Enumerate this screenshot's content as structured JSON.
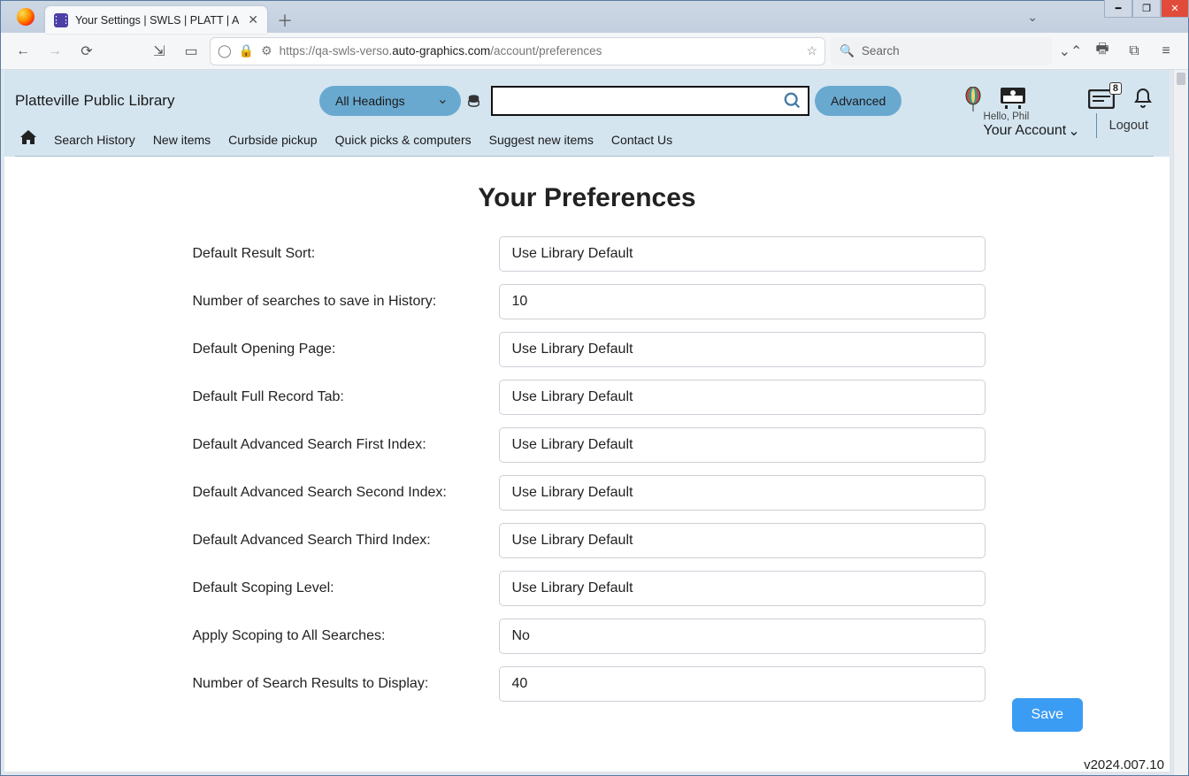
{
  "browser": {
    "tab_title": "Your Settings | SWLS | PLATT | A",
    "url_prefix": "https://qa-swls-verso.",
    "url_domain": "auto-graphics.com",
    "url_path": "/account/preferences",
    "search_placeholder": "Search"
  },
  "header": {
    "library_name": "Platteville Public Library",
    "headings_dropdown": "All Headings",
    "advanced": "Advanced",
    "badge_count": "8",
    "hello": "Hello, Phil",
    "your_account": "Your Account",
    "logout": "Logout"
  },
  "nav": {
    "items": [
      "Search History",
      "New items",
      "Curbside pickup",
      "Quick picks & computers",
      "Suggest new items",
      "Contact Us"
    ]
  },
  "page": {
    "title": "Your Preferences",
    "rows": [
      {
        "label": "Default Result Sort:",
        "value": "Use Library Default"
      },
      {
        "label": "Number of searches to save in History:",
        "value": "10"
      },
      {
        "label": "Default Opening Page:",
        "value": "Use Library Default"
      },
      {
        "label": "Default Full Record Tab:",
        "value": "Use Library Default"
      },
      {
        "label": "Default Advanced Search First Index:",
        "value": "Use Library Default"
      },
      {
        "label": "Default Advanced Search Second Index:",
        "value": "Use Library Default"
      },
      {
        "label": "Default Advanced Search Third Index:",
        "value": "Use Library Default"
      },
      {
        "label": "Default Scoping Level:",
        "value": "Use Library Default"
      },
      {
        "label": "Apply Scoping to All Searches:",
        "value": "No"
      },
      {
        "label": "Number of Search Results to Display:",
        "value": "40"
      }
    ],
    "save": "Save",
    "version": "v2024.007.10"
  }
}
